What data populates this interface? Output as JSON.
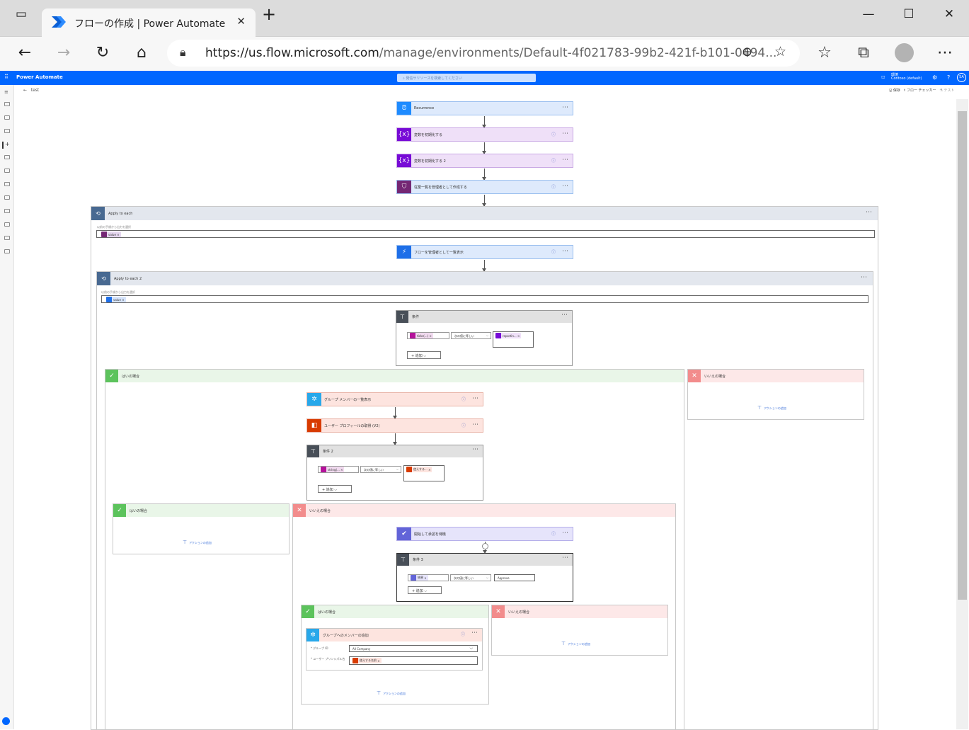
{
  "browser": {
    "tab_title": "フローの作成 | Power Automate",
    "url_host": "https://us.flow.microsoft.com",
    "url_path": "/manage/environments/Default-4f021783-99b2-421f-b101-0494..."
  },
  "app": {
    "brand": "Power Automate",
    "search_placeholder": "発信サリソースを検索してください",
    "environment_label": "環境",
    "environment_name": "Contoso (default)",
    "avatar": "SA",
    "flow_name": "test",
    "actions": {
      "save": "保存",
      "checker": "フロー チェッカー",
      "test": "テスト"
    }
  },
  "flow": {
    "recurrence": "Recurrence",
    "init_var": "変数を初期化する",
    "init_var2": "変数を初期化する 2",
    "create_list": "従業一覧を管理者として作成する",
    "apply1": {
      "title": "Apply to each",
      "label": "以前の手順から出力を選択",
      "token": "value"
    },
    "list_flows": "フローを管理者として一覧表示",
    "apply2": {
      "title": "Apply to each 2",
      "label": "以前の手順から出力を選択",
      "token": "value"
    },
    "cond_main": {
      "title": "条件",
      "left": "ticks(...)",
      "op": "次の値に等しい",
      "right": "reportin...",
      "add": "追加"
    },
    "yes_label": "はいの場合",
    "no_label": "いいえの場合",
    "add_action": "アクションの追加",
    "list_group_members": "グループ メンバーの一覧表示",
    "get_profile": "ユーザー プロフィールの取得 (V2)",
    "cond2": {
      "title": "条件 2",
      "left": "string(...",
      "op": "次の値に等しい",
      "right": "使えする..."
    },
    "approval": "開始して承認を待機",
    "cond3": {
      "title": "条件 3",
      "left": "結果",
      "op": "次の値に等しい",
      "right": "Approve"
    },
    "add_member": {
      "title": "グループへのメンバーの追加",
      "group_label": "* グループ ID",
      "group_value": "All Company",
      "user_label": "* ユーザー プリンシパル名",
      "user_token": "使えする名前"
    }
  },
  "colors": {
    "appbar": "#0066ff",
    "recurrence": "#1e8bff",
    "variable": "#770bd6",
    "office": "#d83b01",
    "scope": "#486991"
  }
}
